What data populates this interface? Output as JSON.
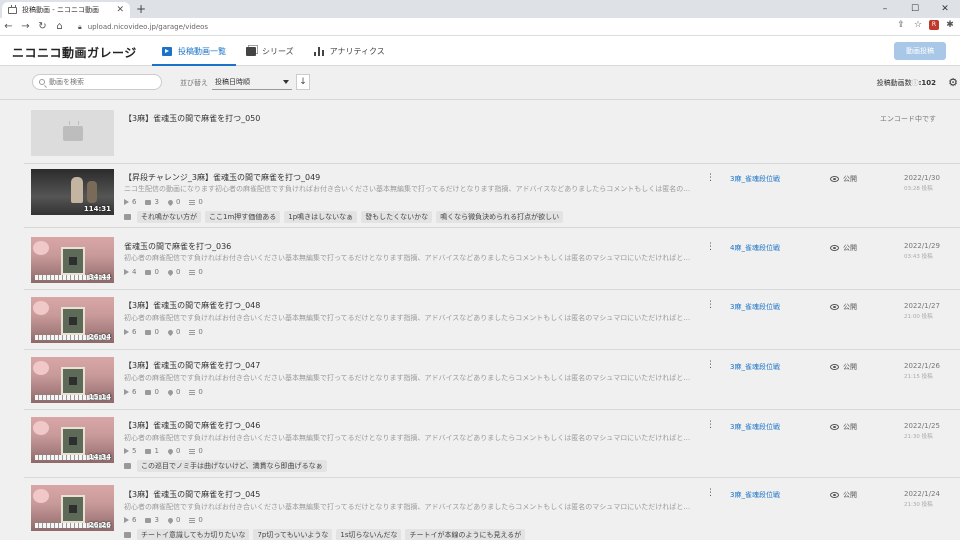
{
  "browser": {
    "tab_title": "投稿動画 - ニコニコ動画",
    "url": "upload.nicovideo.jp/garage/videos",
    "ext_badge": "R"
  },
  "header": {
    "logo": "ニコニコ動画ガレージ",
    "tabs": [
      {
        "label": "投稿動画一覧",
        "icon": "video-icon"
      },
      {
        "label": "シリーズ",
        "icon": "series-icon"
      },
      {
        "label": "アナリティクス",
        "icon": "chart-icon"
      }
    ],
    "upload_label": "動画投稿"
  },
  "filters": {
    "search_placeholder": "動画を検索",
    "sort_label": "並び替え",
    "sort_value": "投稿日時順",
    "count_label": "投稿動画数",
    "count_value": ":102"
  },
  "videos": [
    {
      "title": "【3麻】雀魂玉の間で麻雀を打つ_050",
      "status": "エンコード中です"
    },
    {
      "title": "【昇段チャレンジ_3麻】雀魂玉の間で麻雀を打つ_049",
      "desc": "ニコ生配信の動画になります初心者の麻雀配信です負ければお付き合いください基本無編集で打ってるだけとなります指摘、アドバイスなどありましたらコメントもしくは匿名のマシュマロにいただければ・・・",
      "duration": "114:31",
      "views": "6",
      "comments": "3",
      "likes": "0",
      "mylists": "0",
      "series": "3麻_雀魂段位戦",
      "visibility": "公開",
      "date": "2022/1/30",
      "time": "03:28 投稿",
      "chips": [
        "それ鳴かない方が",
        "ここ1m押す価値ある",
        "1p鳴きはしないなぁ",
        "發もしたくないかな",
        "鳴くなら微負決められる打点が欲しい"
      ]
    },
    {
      "title": "雀魂玉の間で麻雀を打つ_036",
      "desc": "初心者の麻雀配信です負ければお付き合いください基本無編集で打ってるだけとなります指摘、アドバイスなどありましたらコメントもしくは匿名のマシュマロにいただければと思いますマシュマロ：ht・・・",
      "duration": "34:44",
      "views": "4",
      "comments": "0",
      "likes": "0",
      "mylists": "0",
      "series": "4麻_雀魂段位戦",
      "visibility": "公開",
      "date": "2022/1/29",
      "time": "03:43 投稿",
      "chips": []
    },
    {
      "title": "【3麻】雀魂玉の間で麻雀を打つ_048",
      "desc": "初心者の麻雀配信です負ければお付き合いください基本無編集で打ってるだけとなります指摘、アドバイスなどありましたらコメントもしくは匿名のマシュマロにいただければと思いますマシュマロ：ht・・・",
      "duration": "26:04",
      "views": "6",
      "comments": "0",
      "likes": "0",
      "mylists": "0",
      "series": "3麻_雀魂段位戦",
      "visibility": "公開",
      "date": "2022/1/27",
      "time": "21:00 投稿",
      "chips": []
    },
    {
      "title": "【3麻】雀魂玉の間で麻雀を打つ_047",
      "desc": "初心者の麻雀配信です負ければお付き合いください基本無編集で打ってるだけとなります指摘、アドバイスなどありましたらコメントもしくは匿名のマシュマロにいただければと思いますマシュマロ：ht・・・",
      "duration": "15:14",
      "views": "6",
      "comments": "0",
      "likes": "0",
      "mylists": "0",
      "series": "3麻_雀魂段位戦",
      "visibility": "公開",
      "date": "2022/1/26",
      "time": "21:15 投稿",
      "chips": []
    },
    {
      "title": "【3麻】雀魂玉の間で麻雀を打つ_046",
      "desc": "初心者の麻雀配信です負ければお付き合いください基本無編集で打ってるだけとなります指摘、アドバイスなどありましたらコメントもしくは匿名のマシュマロにいただければと思いますマシュマロ：ht・・・",
      "duration": "14:34",
      "views": "5",
      "comments": "1",
      "likes": "0",
      "mylists": "0",
      "series": "3麻_雀魂段位戦",
      "visibility": "公開",
      "date": "2022/1/25",
      "time": "21:30 投稿",
      "chips": [
        "この巡目でノミ手は曲げないけど、満貫なら即曲げるなぁ"
      ]
    },
    {
      "title": "【3麻】雀魂玉の間で麻雀を打つ_045",
      "desc": "初心者の麻雀配信です負ければお付き合いください基本無編集で打ってるだけとなります指摘、アドバイスなどありましたらコメントもしくは匿名のマシュマロにいただければと思いますマシュマロ：ht・・・",
      "duration": "26:26",
      "views": "6",
      "comments": "3",
      "likes": "0",
      "mylists": "0",
      "series": "3麻_雀魂段位戦",
      "visibility": "公開",
      "date": "2022/1/24",
      "time": "21:30 投稿",
      "chips": [
        "チートイ意識してもカ切りたいな",
        "7p切ってもいいような",
        "1s切らないんだな",
        "チートイが本線のようにも見えるが"
      ]
    }
  ]
}
